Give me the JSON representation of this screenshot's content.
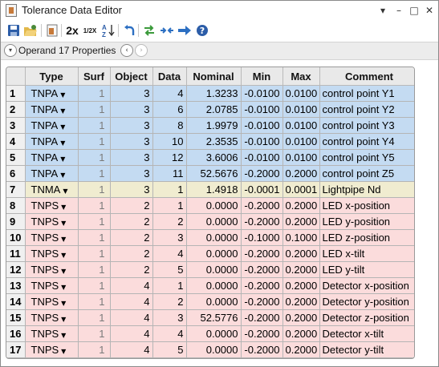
{
  "window": {
    "title": "Tolerance Data Editor",
    "controls": {
      "menu": "▾",
      "minimize": "–",
      "maximize": "□",
      "close": "✕"
    }
  },
  "toolbar": {
    "zoom_label": "2x",
    "half_label": "1/2X",
    "sort_label": "AZ",
    "icons": [
      "save-icon",
      "open-icon",
      "document-icon",
      "zoom-2x",
      "zoom-half",
      "sort-az-icon",
      "undo-icon",
      "swap-icon",
      "compress-icon",
      "arrow-right-icon",
      "help-icon"
    ]
  },
  "props": {
    "label": "Operand 17 Properties",
    "prev": "‹",
    "next": "›"
  },
  "columns": [
    "",
    "Type",
    "Surf",
    "Object",
    "Data",
    "Nominal",
    "Min",
    "Max",
    "Comment"
  ],
  "rows": [
    {
      "n": "1",
      "type": "TNPA",
      "surf": "1",
      "object": "3",
      "data": "4",
      "nominal": "1.3233",
      "min": "-0.0100",
      "max": "0.0100",
      "comment": "control point Y1",
      "color": "blue"
    },
    {
      "n": "2",
      "type": "TNPA",
      "surf": "1",
      "object": "3",
      "data": "6",
      "nominal": "2.0785",
      "min": "-0.0100",
      "max": "0.0100",
      "comment": "control point Y2",
      "color": "blue"
    },
    {
      "n": "3",
      "type": "TNPA",
      "surf": "1",
      "object": "3",
      "data": "8",
      "nominal": "1.9979",
      "min": "-0.0100",
      "max": "0.0100",
      "comment": "control point Y3",
      "color": "blue"
    },
    {
      "n": "4",
      "type": "TNPA",
      "surf": "1",
      "object": "3",
      "data": "10",
      "nominal": "2.3535",
      "min": "-0.0100",
      "max": "0.0100",
      "comment": "control point Y4",
      "color": "blue"
    },
    {
      "n": "5",
      "type": "TNPA",
      "surf": "1",
      "object": "3",
      "data": "12",
      "nominal": "3.6006",
      "min": "-0.0100",
      "max": "0.0100",
      "comment": "control point Y5",
      "color": "blue"
    },
    {
      "n": "6",
      "type": "TNPA",
      "surf": "1",
      "object": "3",
      "data": "11",
      "nominal": "52.5676",
      "min": "-0.2000",
      "max": "0.2000",
      "comment": "control point Z5",
      "color": "blue"
    },
    {
      "n": "7",
      "type": "TNMA",
      "surf": "1",
      "object": "3",
      "data": "1",
      "nominal": "1.4918",
      "min": "-0.0001",
      "max": "0.0001",
      "comment": "Lightpipe Nd",
      "color": "yellow"
    },
    {
      "n": "8",
      "type": "TNPS",
      "surf": "1",
      "object": "2",
      "data": "1",
      "nominal": "0.0000",
      "min": "-0.2000",
      "max": "0.2000",
      "comment": "LED x-position",
      "color": "red"
    },
    {
      "n": "9",
      "type": "TNPS",
      "surf": "1",
      "object": "2",
      "data": "2",
      "nominal": "0.0000",
      "min": "-0.2000",
      "max": "0.2000",
      "comment": "LED y-position",
      "color": "red"
    },
    {
      "n": "10",
      "type": "TNPS",
      "surf": "1",
      "object": "2",
      "data": "3",
      "nominal": "0.0000",
      "min": "-0.1000",
      "max": "0.1000",
      "comment": "LED z-position",
      "color": "red"
    },
    {
      "n": "11",
      "type": "TNPS",
      "surf": "1",
      "object": "2",
      "data": "4",
      "nominal": "0.0000",
      "min": "-0.2000",
      "max": "0.2000",
      "comment": "LED x-tilt",
      "color": "red"
    },
    {
      "n": "12",
      "type": "TNPS",
      "surf": "1",
      "object": "2",
      "data": "5",
      "nominal": "0.0000",
      "min": "-0.2000",
      "max": "0.2000",
      "comment": "LED y-tilt",
      "color": "red"
    },
    {
      "n": "13",
      "type": "TNPS",
      "surf": "1",
      "object": "4",
      "data": "1",
      "nominal": "0.0000",
      "min": "-0.2000",
      "max": "0.2000",
      "comment": "Detector x-position",
      "color": "red"
    },
    {
      "n": "14",
      "type": "TNPS",
      "surf": "1",
      "object": "4",
      "data": "2",
      "nominal": "0.0000",
      "min": "-0.2000",
      "max": "0.2000",
      "comment": "Detector y-position",
      "color": "red"
    },
    {
      "n": "15",
      "type": "TNPS",
      "surf": "1",
      "object": "4",
      "data": "3",
      "nominal": "52.5776",
      "min": "-0.2000",
      "max": "0.2000",
      "comment": "Detector z-position",
      "color": "red"
    },
    {
      "n": "16",
      "type": "TNPS",
      "surf": "1",
      "object": "4",
      "data": "4",
      "nominal": "0.0000",
      "min": "-0.2000",
      "max": "0.2000",
      "comment": "Detector x-tilt",
      "color": "red"
    },
    {
      "n": "17",
      "type": "TNPS",
      "surf": "1",
      "object": "4",
      "data": "5",
      "nominal": "0.0000",
      "min": "-0.2000",
      "max": "0.2000",
      "comment": "Detector y-tilt",
      "color": "red"
    }
  ]
}
